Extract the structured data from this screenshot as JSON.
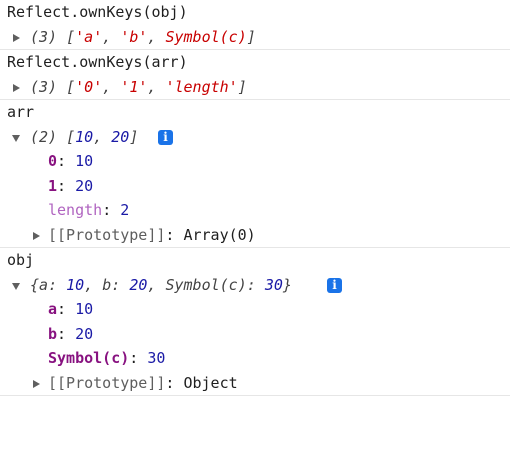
{
  "console": {
    "entries": [
      {
        "input": "Reflect.ownKeys(obj)",
        "result": {
          "count": "(3)",
          "open": "[",
          "items": [
            "'a'",
            "'b'",
            "Symbol(c)"
          ],
          "sep": ", ",
          "close": "]"
        }
      },
      {
        "input": "Reflect.ownKeys(arr)",
        "result": {
          "count": "(3)",
          "open": "[",
          "items": [
            "'0'",
            "'1'",
            "'length'"
          ],
          "sep": ", ",
          "close": "]"
        }
      },
      {
        "input": "arr",
        "result": {
          "count": "(2)",
          "open": "[",
          "items": [
            "10",
            "20"
          ],
          "sep": ", ",
          "close": "]",
          "properties": [
            {
              "key": "0",
              "colon": ":",
              "value": "10"
            },
            {
              "key": "1",
              "colon": ":",
              "value": "20"
            },
            {
              "key": "length",
              "colon": ":",
              "value": "2"
            }
          ],
          "prototype": {
            "key": "[[Prototype]]",
            "colon": ":",
            "value": "Array(0)"
          }
        }
      },
      {
        "input": "obj",
        "result": {
          "open": "{",
          "items": [
            {
              "key": "a",
              "colon": ": ",
              "value": "10"
            },
            {
              "key": "b",
              "colon": ": ",
              "value": "20"
            },
            {
              "key": "Symbol(c)",
              "colon": ": ",
              "value": "30"
            }
          ],
          "sep": ", ",
          "close": "}",
          "properties": [
            {
              "key": "a",
              "colon": ":",
              "value": "10"
            },
            {
              "key": "b",
              "colon": ":",
              "value": "20"
            },
            {
              "key": "Symbol(c)",
              "colon": ":",
              "value": "30"
            }
          ],
          "prototype": {
            "key": "[[Prototype]]",
            "colon": ":",
            "value": "Object"
          }
        }
      }
    ],
    "info_icon": "i"
  },
  "colors": {
    "string": "#c80000",
    "number": "#1a1aa6",
    "own_key": "#881280",
    "length_key": "#b064c0",
    "info_badge": "#1a73e8",
    "separator": "#e6e6e6"
  },
  "icons": [
    "expand-arrow-right-icon",
    "collapse-arrow-down-icon",
    "info-icon"
  ]
}
